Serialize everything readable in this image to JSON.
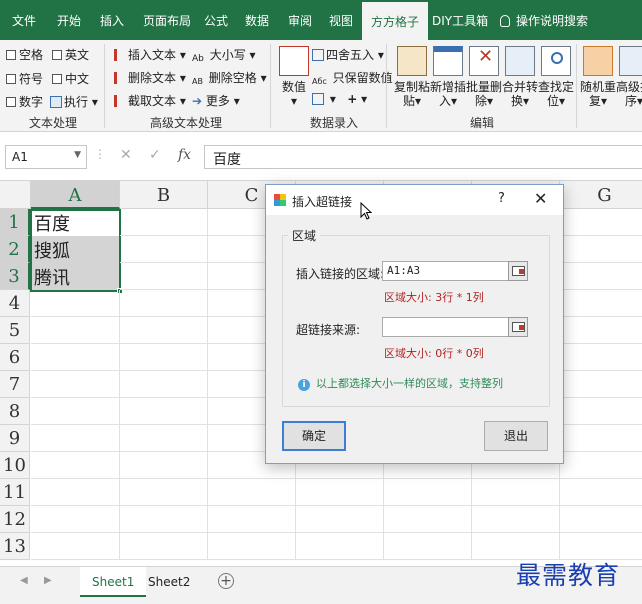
{
  "ribbon_tabs": [
    "文件",
    "开始",
    "插入",
    "页面布局",
    "公式",
    "数据",
    "审阅",
    "视图",
    "方方格子",
    "DIY工具箱",
    "操作说明搜索"
  ],
  "active_tab": "方方格子",
  "colors": {
    "excel_green": "#217346",
    "dialog_border": "#7a9ec9",
    "info_green": "#2e8b57",
    "size_red": "#b22222",
    "watermark_blue": "#1a3fb0"
  },
  "text_group": {
    "checkboxes": [
      "空格",
      "英文",
      "符号",
      "中文",
      "数字"
    ],
    "execute": "执行",
    "label": "文本处理"
  },
  "advanced_text_group": {
    "items": [
      "插入文本",
      "删除文本",
      "截取文本",
      "大小写",
      "删除空格",
      "更多"
    ],
    "label": "高级文本处理"
  },
  "data_entry_group": {
    "numeric": "数值",
    "items": [
      "四舍五入",
      "只保留数值"
    ],
    "label": "数据录入"
  },
  "edit_group": {
    "buttons": [
      {
        "label": "复制粘贴",
        "icon": "copy-paste-icon"
      },
      {
        "label": "新增插入",
        "icon": "insert-row-icon"
      },
      {
        "label": "批量删除",
        "icon": "batch-delete-icon"
      },
      {
        "label": "合并转换",
        "icon": "merge-convert-icon"
      },
      {
        "label": "查找定位",
        "icon": "find-locate-icon"
      }
    ],
    "label": "编辑"
  },
  "extra_group": {
    "buttons": [
      {
        "label": "随机重复",
        "icon": "random-icon"
      },
      {
        "label": "高级排序",
        "icon": "sort-az-icon"
      }
    ]
  },
  "formula_bar": {
    "name_box": "A1",
    "formula": "百度"
  },
  "columns": [
    "A",
    "B",
    "C",
    "D",
    "E",
    "F",
    "G"
  ],
  "rows": [
    "1",
    "2",
    "3",
    "4",
    "5",
    "6",
    "7",
    "8",
    "9",
    "10",
    "11",
    "12",
    "13"
  ],
  "cells": {
    "A1": "百度",
    "A2": "搜狐",
    "A3": "腾讯"
  },
  "sheets": [
    "Sheet1",
    "Sheet2"
  ],
  "active_sheet": "Sheet1",
  "dialog": {
    "title": "插入超链接",
    "help": "?",
    "close": "✕",
    "group_label": "区域",
    "range_label": "插入链接的区域:",
    "range_value": "A1:A3",
    "range_size": "区域大小:  3行 * 1列",
    "source_label": "超链接来源:",
    "source_value": "",
    "source_size": "区域大小:  0行 * 0列",
    "info": "以上都选择大小一样的区域，支持整列",
    "ok": "确定",
    "exit": "退出"
  },
  "watermark": "最需教育"
}
